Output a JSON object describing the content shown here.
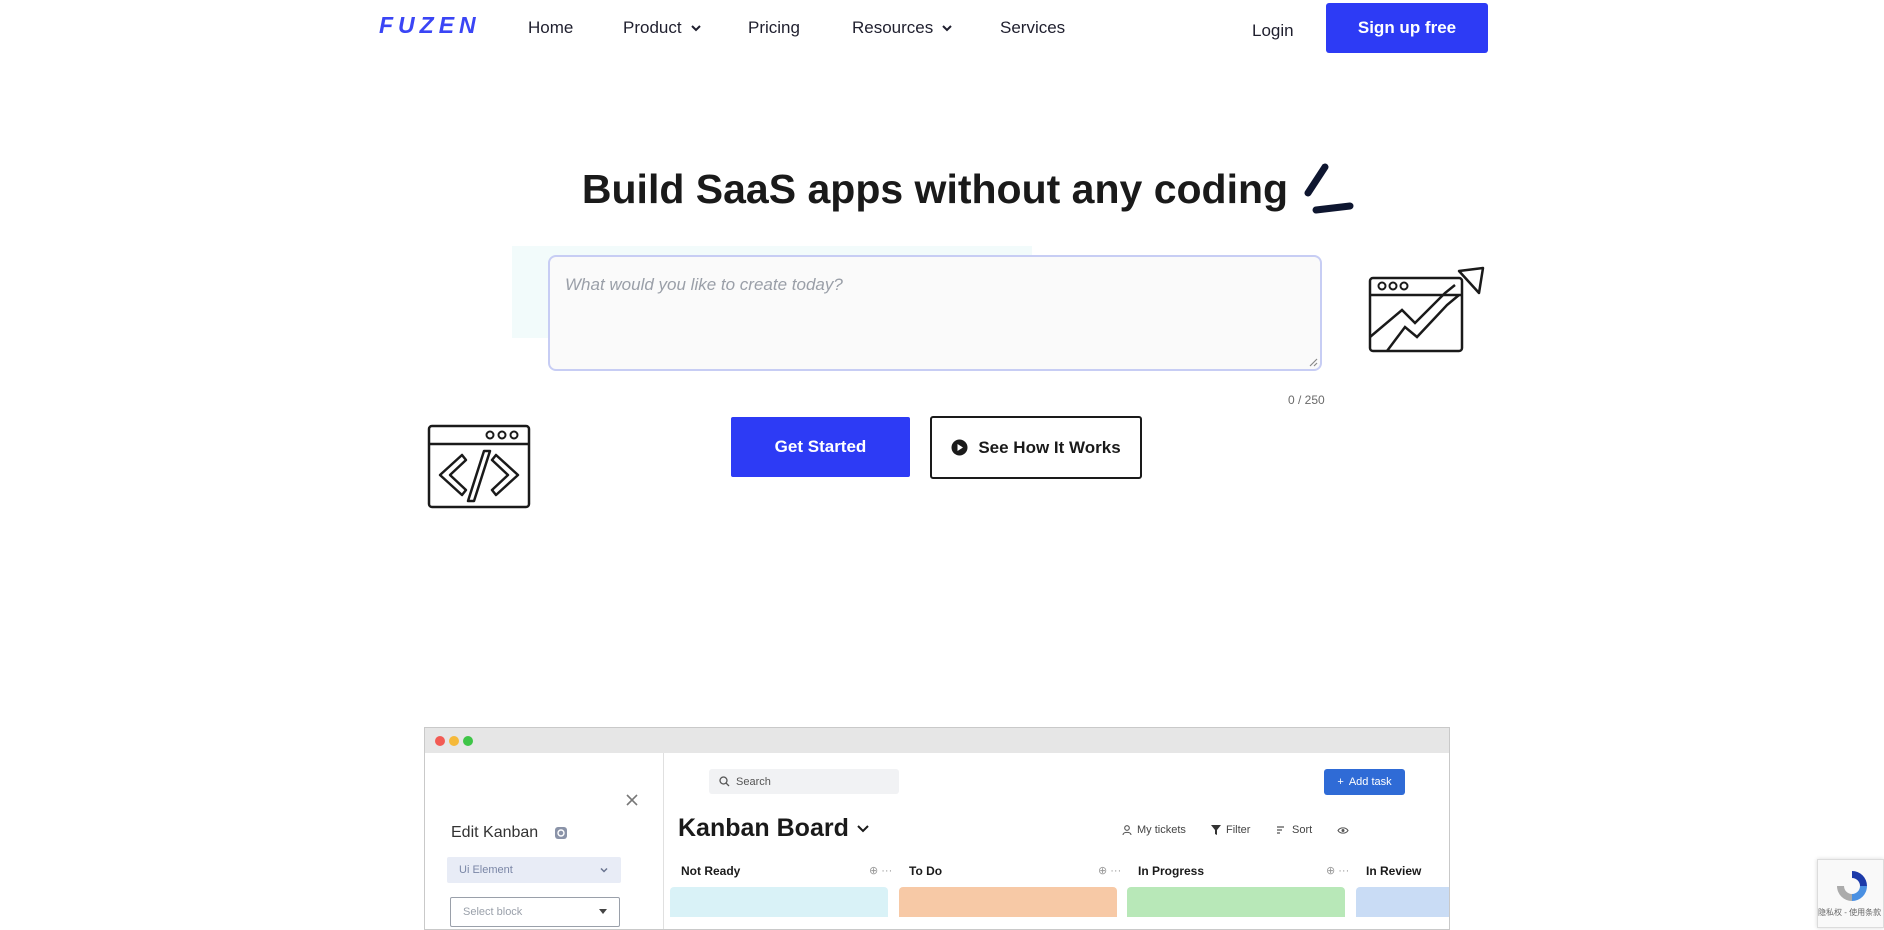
{
  "nav": {
    "logo": "FUZEN",
    "items": [
      {
        "label": "Home"
      },
      {
        "label": "Product"
      },
      {
        "label": "Pricing"
      },
      {
        "label": "Resources"
      },
      {
        "label": "Services"
      }
    ],
    "login": "Login",
    "signup": "Sign up free",
    "accent": "#2d3bf5"
  },
  "hero": {
    "headline": "Build SaaS apps without any coding",
    "prompt_placeholder": "What would you like to create today?",
    "char_count": "0 / 250",
    "get_started": "Get Started",
    "see_how": "See How It Works"
  },
  "mockup": {
    "sidebar": {
      "title": "Edit Kanban",
      "element_select": "Ui Element",
      "block_select": "Select block"
    },
    "search": "Search",
    "add_task": "Add task",
    "board_title": "Kanban Board",
    "tools": [
      "My tickets",
      "Filter",
      "Sort"
    ],
    "columns": [
      {
        "name": "Not Ready",
        "color": "#d9f2f7"
      },
      {
        "name": "To Do",
        "color": "#f7c9a6"
      },
      {
        "name": "In Progress",
        "color": "#b8e8b8"
      },
      {
        "name": "In Review",
        "color": "#c9dcf5"
      }
    ]
  },
  "recaptcha": {
    "footer": "隐私权 - 使用条款"
  }
}
